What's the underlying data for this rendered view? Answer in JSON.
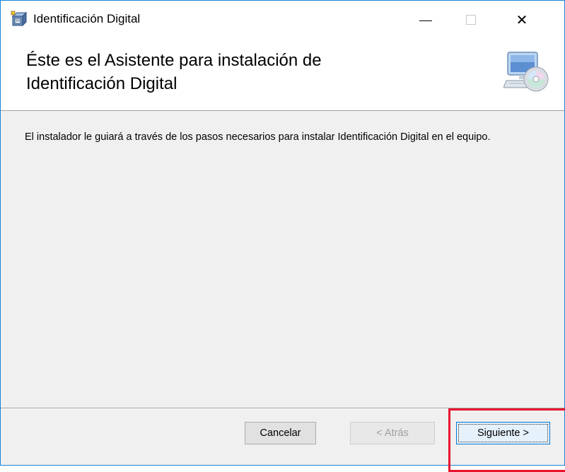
{
  "window": {
    "title": "Identificación Digital",
    "icon": "installer-box-icon",
    "controls": {
      "minimize": "minimize-icon",
      "maximize": "maximize-icon",
      "close": "close-icon",
      "close_glyph": "✕"
    }
  },
  "banner": {
    "heading_line1": "Éste es el Asistente para instalación de",
    "heading_line2": "Identificación Digital",
    "icon": "computer-cd-icon"
  },
  "body": {
    "description": "El instalador le guiará a través de los pasos necesarios para instalar Identificación Digital en el equipo."
  },
  "buttons": {
    "cancel_label": "Cancelar",
    "back_label": "< Atrás",
    "next_label": "Siguiente >"
  },
  "colors": {
    "window_border": "#1883d7",
    "highlight": "#e8112d",
    "focus_button_border": "#0078d7"
  }
}
